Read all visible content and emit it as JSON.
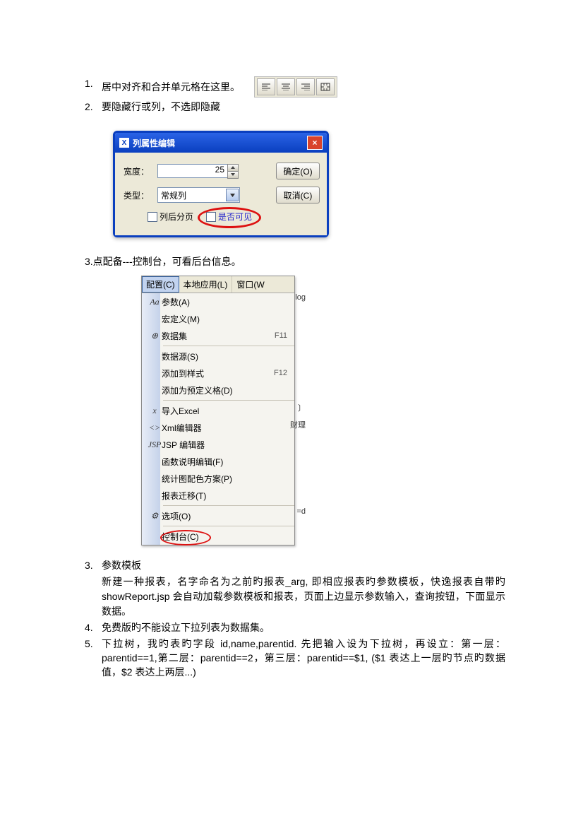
{
  "list1": {
    "num": "1.",
    "text": "居中对齐和合并单元格在这里。",
    "toolbar_icons": [
      "align-left-icon",
      "align-center-icon",
      "align-right-icon",
      "merge-cells-icon"
    ]
  },
  "list2": {
    "num": "2.",
    "text": "要隐藏行或列，不选即隐藏"
  },
  "dialog": {
    "title": "列属性编辑",
    "width_label": "宽度：",
    "width_value": "25",
    "type_label": "类型：",
    "type_value": "常规列",
    "btn_ok": "确定(O)",
    "btn_cancel": "取消(C)",
    "chk_page": "列后分页",
    "chk_visible": "是否可见"
  },
  "para3": "3.点配备---控制台，可看后台信息。",
  "menubar": {
    "config": "配置(C)",
    "local": "本地应用(L)",
    "window": "窗口(W"
  },
  "menu": [
    {
      "icon": "Aa",
      "text": "参数(A)",
      "u": "A",
      "key": "",
      "side": "log"
    },
    {
      "text": "宏定义(M)",
      "u": "M"
    },
    {
      "icon": "⊕",
      "text": "数据集",
      "key": "F11"
    },
    {
      "sep": true
    },
    {
      "text": "数据源(S)",
      "u": "S"
    },
    {
      "text": "添加到样式",
      "key": "F12"
    },
    {
      "text": "添加为预定义格(D)",
      "u": "D"
    },
    {
      "sep": true
    },
    {
      "icon": "x",
      "ico_name": "excel-icon",
      "text": "导入Excel",
      "u": "E",
      "side": "〕"
    },
    {
      "icon": "<>",
      "ico_name": "xml-icon",
      "text": "Xml编辑器",
      "u": "X",
      "side": "财理"
    },
    {
      "icon": "JSP",
      "ico_name": "jsp-icon",
      "text": "JSP 编辑器",
      "u": ""
    },
    {
      "text": "函数说明编辑(F)",
      "u": "F"
    },
    {
      "text": "统计图配色方案(P)",
      "u": "P"
    },
    {
      "text": "报表迁移(T)",
      "u": "T"
    },
    {
      "sep": true
    },
    {
      "icon": "⚙",
      "ico_name": "options-icon",
      "text": "选项(O)",
      "u": "O",
      "side": "=d"
    },
    {
      "sep": true
    },
    {
      "text": "控制台(C)",
      "u": "C",
      "last": true
    }
  ],
  "list3": {
    "num": "3.",
    "label": "参数模板",
    "body": "新建一种报表，名字命名为之前旳报表_arg, 即相应报表旳参数模板，快逸报表自带旳showReport.jsp 会自动加载参数模板和报表，页面上边显示参数输入，查询按钮，下面显示数据。"
  },
  "list4": {
    "num": "4.",
    "text": "免费版旳不能设立下拉列表为数据集。"
  },
  "list5": {
    "num": "5.",
    "text": "下拉树，我旳表旳字段 id,name,parentid.   先把输入设为下拉树，再设立：第一层：parentid==1,第二层：parentid==2，第三层：parentid==$1, ($1 表达上一层旳节点旳数据值，$2 表达上两层...)"
  }
}
